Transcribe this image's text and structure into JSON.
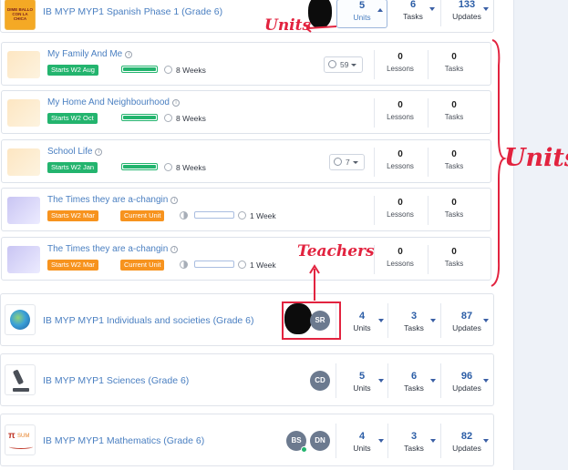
{
  "courses": [
    {
      "title": "IB MYP MYP1 Spanish Phase 1 (Grade 6)",
      "thumb_text": "DIME BALLO CON LA CHICA",
      "teachers": [],
      "units": {
        "value": "5",
        "label": "Units"
      },
      "tasks": {
        "value": "6",
        "label": "Tasks"
      },
      "updates": {
        "value": "133",
        "label": "Updates"
      }
    },
    {
      "title": "IB MYP MYP1 Individuals and societies (Grade 6)",
      "teachers": [
        "SR"
      ],
      "units": {
        "value": "4",
        "label": "Units"
      },
      "tasks": {
        "value": "3",
        "label": "Tasks"
      },
      "updates": {
        "value": "87",
        "label": "Updates"
      }
    },
    {
      "title": "IB MYP MYP1 Sciences (Grade 6)",
      "teachers": [
        "CD"
      ],
      "units": {
        "value": "5",
        "label": "Units"
      },
      "tasks": {
        "value": "6",
        "label": "Tasks"
      },
      "updates": {
        "value": "96",
        "label": "Updates"
      }
    },
    {
      "title": "IB MYP MYP1 Mathematics (Grade 6)",
      "thumb_text": "SUM",
      "teachers": [
        "BS",
        "DN"
      ],
      "units": {
        "value": "4",
        "label": "Units"
      },
      "tasks": {
        "value": "3",
        "label": "Tasks"
      },
      "updates": {
        "value": "82",
        "label": "Updates"
      }
    }
  ],
  "units": [
    {
      "title": "My Family And Me",
      "start": "Starts W2 Aug",
      "current": "",
      "duration": "8 Weeks",
      "progress": 1.0,
      "resources": "59",
      "lessons": {
        "value": "0",
        "label": "Lessons"
      },
      "tasks": {
        "value": "0",
        "label": "Tasks"
      }
    },
    {
      "title": "My Home And Neighbourhood",
      "start": "Starts W2 Oct",
      "current": "",
      "duration": "8 Weeks",
      "progress": 1.0,
      "resources": "",
      "lessons": {
        "value": "0",
        "label": "Lessons"
      },
      "tasks": {
        "value": "0",
        "label": "Tasks"
      }
    },
    {
      "title": "School Life",
      "start": "Starts W2 Jan",
      "current": "",
      "duration": "8 Weeks",
      "progress": 1.0,
      "resources": "7",
      "lessons": {
        "value": "0",
        "label": "Lessons"
      },
      "tasks": {
        "value": "0",
        "label": "Tasks"
      }
    },
    {
      "title": "The Times they are a-changin",
      "start": "Starts W2 Mar",
      "current": "Current Unit",
      "duration": "1 Week",
      "progress": 0.0,
      "resources": "",
      "lessons": {
        "value": "0",
        "label": "Lessons"
      },
      "tasks": {
        "value": "0",
        "label": "Tasks"
      }
    },
    {
      "title": "The Times they are a-changin",
      "start": "Starts W2 Mar",
      "current": "Current Unit",
      "duration": "1 Week",
      "progress": 0.0,
      "resources": "",
      "lessons": {
        "value": "0",
        "label": "Lessons"
      },
      "tasks": {
        "value": "0",
        "label": "Tasks"
      }
    }
  ],
  "annotations": {
    "units_top": "Units",
    "units_side": "Units",
    "teachers": "Teachers"
  },
  "colors": {
    "accent_blue": "#4a7fc1",
    "green": "#23b46e",
    "orange": "#f7931e",
    "annotation_red": "#e2233f"
  }
}
